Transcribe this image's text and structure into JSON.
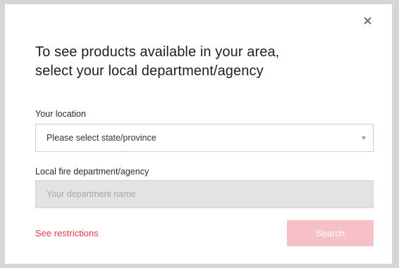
{
  "modal": {
    "title_line1": "To see products available in your area,",
    "title_line2": "select your local department/agency",
    "close_symbol": "×"
  },
  "location": {
    "label": "Your location",
    "selected_value": "Please select state/province"
  },
  "department": {
    "label": "Local fire department/agency",
    "placeholder": "Your department name",
    "value": ""
  },
  "footer": {
    "restrictions_link": "See restrictions",
    "search_button": "Search"
  },
  "colors": {
    "accent": "#e03a4c",
    "button_disabled": "#f7c0c6",
    "input_disabled": "#e3e3e3"
  },
  "icons": {
    "close": "close-icon",
    "dropdown": "chevron-down-icon"
  }
}
